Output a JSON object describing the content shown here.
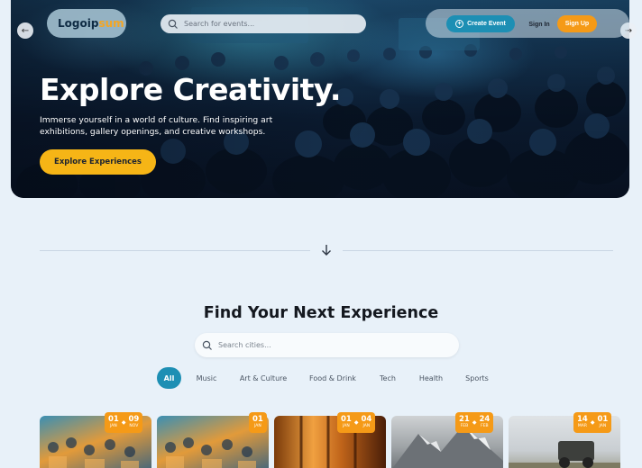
{
  "header": {
    "logo_main": "Logoip",
    "logo_accent": "sum",
    "search_placeholder": "Search for events...",
    "create_label": "Create Event",
    "signin_label": "Sign In",
    "signup_label": "Sign Up"
  },
  "hero": {
    "title": "Explore Creativity.",
    "subtitle": "Immerse yourself in a world of culture. Find inspiring art exhibitions, gallery openings, and creative workshops.",
    "cta": "Explore Experiences"
  },
  "section": {
    "title": "Find Your Next Experience",
    "city_placeholder": "Search cities..."
  },
  "filters": [
    "All",
    "Music",
    "Art & Culture",
    "Food & Drink",
    "Tech",
    "Health",
    "Sports"
  ],
  "active_filter": "All",
  "cards": [
    {
      "start_day": "01",
      "start_mon": "JAN",
      "end_day": "09",
      "end_mon": "NOV"
    },
    {
      "start_day": "01",
      "start_mon": "JAN"
    },
    {
      "start_day": "01",
      "start_mon": "JAN",
      "end_day": "04",
      "end_mon": "JAN"
    },
    {
      "start_day": "21",
      "start_mon": "FEB",
      "end_day": "24",
      "end_mon": "FEB"
    },
    {
      "start_day": "14",
      "start_mon": "MAR",
      "end_day": "01",
      "end_mon": "JAN"
    }
  ],
  "colors": {
    "accent_blue": "#1d8fb4",
    "accent_orange": "#f59a17",
    "cta_yellow": "#f6b516",
    "page_bg": "#e8f1f9"
  }
}
